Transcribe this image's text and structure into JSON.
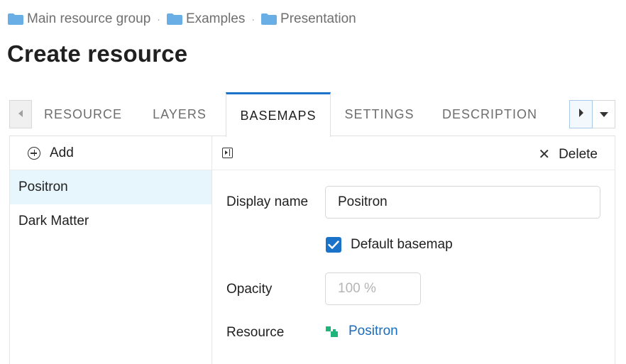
{
  "breadcrumb": {
    "items": [
      "Main resource group",
      "Examples",
      "Presentation"
    ],
    "separator": "·"
  },
  "page": {
    "title": "Create resource"
  },
  "tabs": {
    "items": [
      "RESOURCE",
      "LAYERS",
      "BASEMAPS",
      "SETTINGS",
      "DESCRIPTION"
    ],
    "active": "BASEMAPS"
  },
  "basemaps": {
    "add_label": "Add",
    "delete_label": "Delete",
    "items": [
      "Positron",
      "Dark Matter"
    ],
    "selected": "Positron"
  },
  "form": {
    "display_name_label": "Display name",
    "display_name_value": "Positron",
    "default_basemap_label": "Default basemap",
    "default_basemap_checked": true,
    "opacity_label": "Opacity",
    "opacity_placeholder": "100 %",
    "resource_label": "Resource",
    "resource_value": "Positron"
  },
  "colors": {
    "accent": "#1a73c9",
    "folder": "#6aaee6",
    "selected_row": "#e7f6fd",
    "resource_icon": "#1fb57a"
  },
  "icons": {
    "folder": "folder-icon",
    "add": "plus-circle-icon",
    "toggle_panel": "panel-toggle-icon",
    "delete": "close-icon",
    "resource": "basemap-resource-icon"
  }
}
